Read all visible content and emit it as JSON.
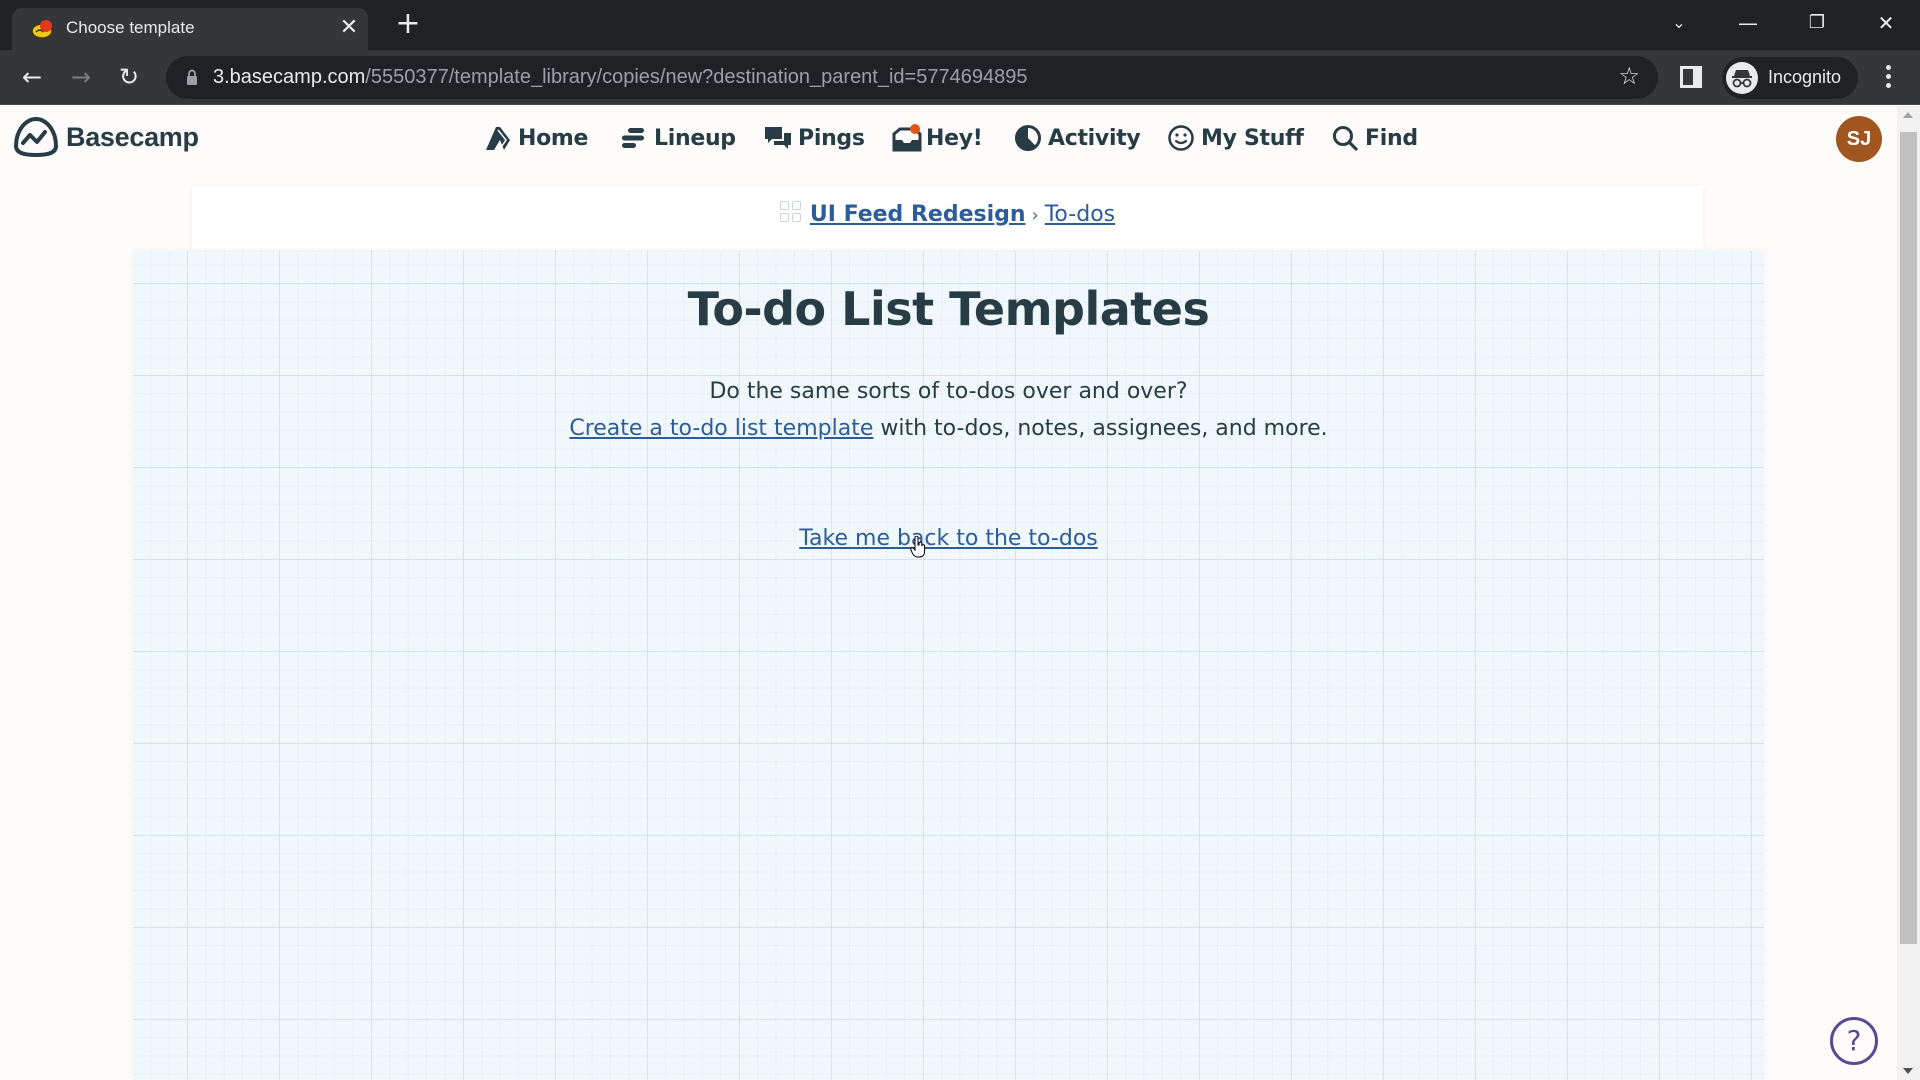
{
  "browser": {
    "tab_title": "Choose template",
    "url_host": "3.basecamp.com",
    "url_path": "/5550377/template_library/copies/new?destination_parent_id=5774694895",
    "profile_label": "Incognito"
  },
  "app": {
    "brand": "Basecamp",
    "nav": [
      {
        "label": "Home",
        "icon": "home-icon"
      },
      {
        "label": "Lineup",
        "icon": "lineup-icon"
      },
      {
        "label": "Pings",
        "icon": "pings-icon"
      },
      {
        "label": "Hey!",
        "icon": "hey-icon",
        "has_notification": true
      },
      {
        "label": "Activity",
        "icon": "activity-icon"
      },
      {
        "label": "My Stuff",
        "icon": "my-stuff-icon"
      },
      {
        "label": "Find",
        "icon": "search-icon"
      }
    ],
    "avatar_initials": "SJ",
    "avatar_color": "#a0561e",
    "notification_color": "#e5531a"
  },
  "breadcrumb": {
    "project": "UI Feed Redesign",
    "separator": "›",
    "section": "To-dos"
  },
  "main": {
    "title": "To-do List Templates",
    "intro_line1": "Do the same sorts of to-dos over and over?",
    "create_link": "Create a to-do list template",
    "intro_line2_rest": " with to-dos, notes, assignees, and more.",
    "back_link": "Take me back to the to-dos"
  },
  "help": {
    "label": "?"
  },
  "colors": {
    "link": "#2c5c9a",
    "text": "#283c46",
    "help": "#5a4a8f"
  }
}
